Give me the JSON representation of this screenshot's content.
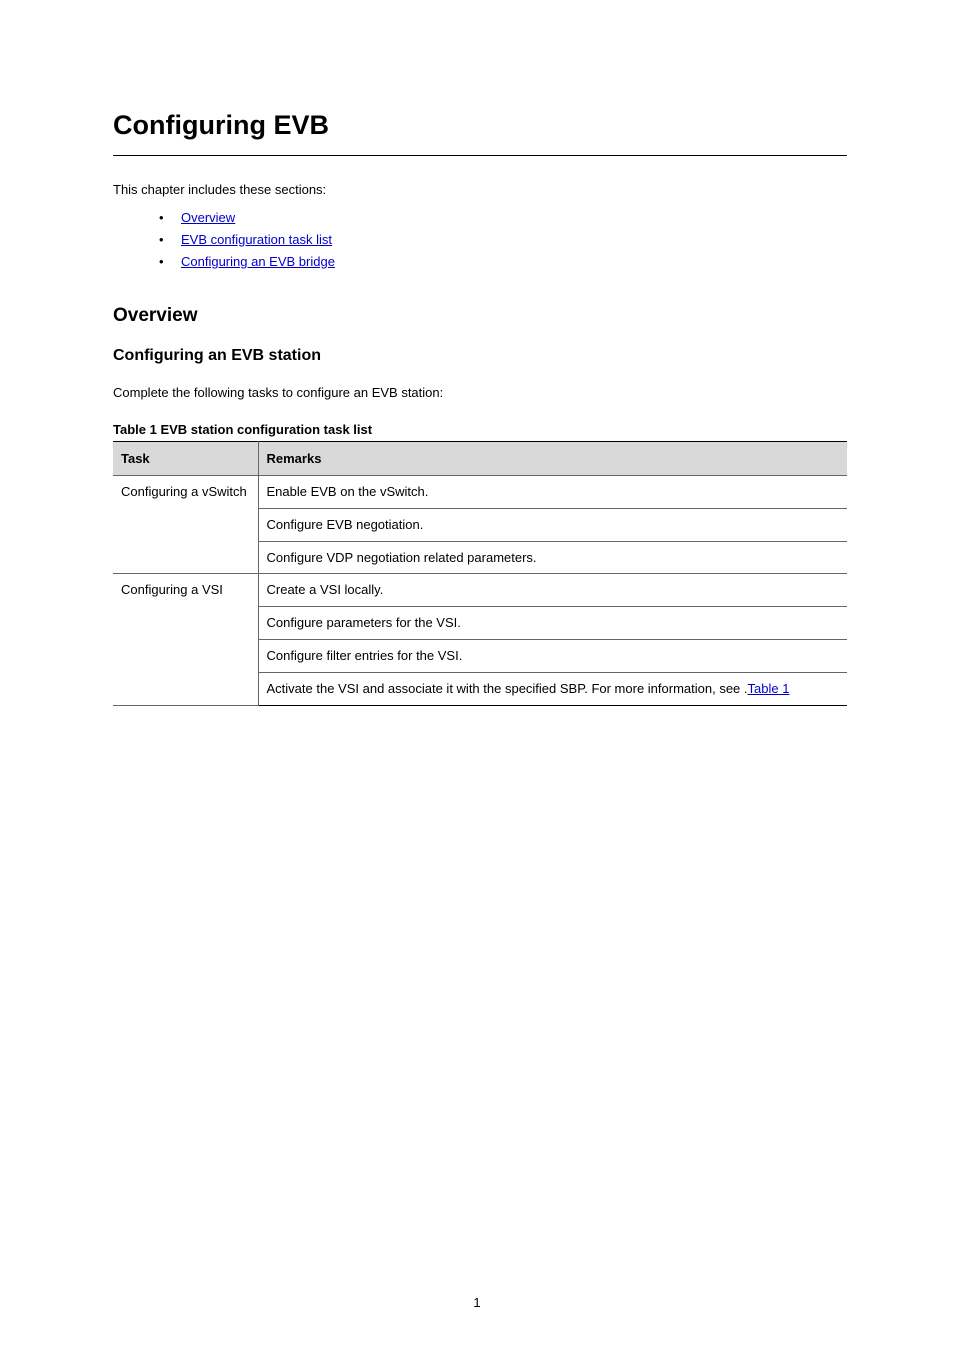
{
  "title": "Configuring EVB",
  "intro": "This chapter includes these sections:",
  "toc": [
    {
      "label": "Overview"
    },
    {
      "label": "EVB configuration task list"
    },
    {
      "label": "Configuring an EVB bridge"
    }
  ],
  "overview": {
    "heading": "Overview",
    "subheading": "Configuring an EVB station",
    "paragraph": "Complete the following tasks to configure an EVB station:",
    "table": {
      "caption": "Table 1 EVB station configuration task list",
      "cols": [
        "Task",
        "Remarks"
      ],
      "group1": {
        "label": "Configuring a vSwitch",
        "rows": [
          "Enable EVB on the vSwitch.",
          "Configure EVB negotiation.",
          "Configure VDP negotiation related parameters."
        ]
      },
      "group2": {
        "label": "Configuring a VSI",
        "rows": [
          "Create a VSI locally.",
          "Configure parameters for the VSI.",
          "Configure filter entries for the VSI.",
          {
            "pre": "Activate the VSI and associate it with the specified SBP. For more information, ",
            "link": "Table 1",
            "post": "see ."
          }
        ]
      }
    }
  },
  "footer": "1"
}
